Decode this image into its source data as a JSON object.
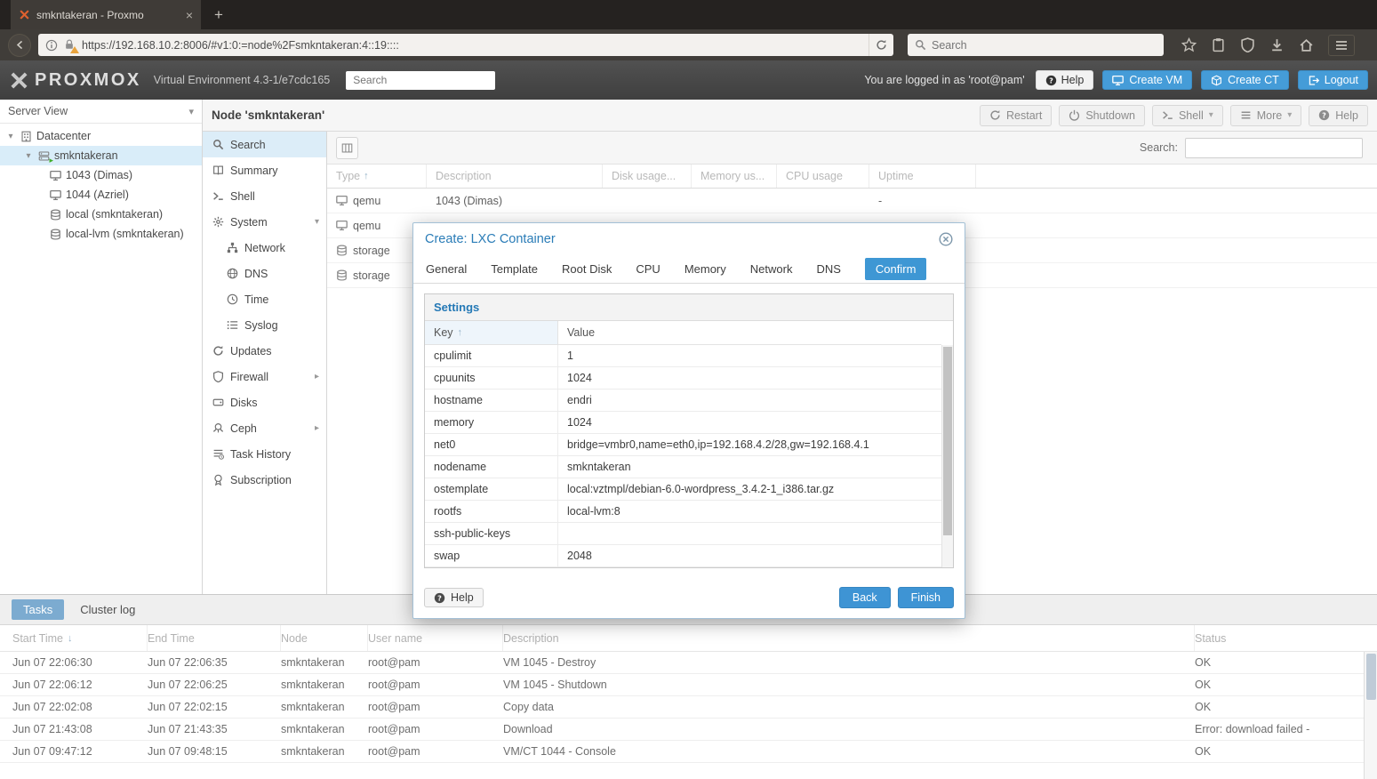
{
  "colors": {
    "button_blue": "#459cd8",
    "modal_title_blue": "#2a7cb7",
    "active_tab_blue": "#3e97d4",
    "tree_selection_blue": "#d9edf9",
    "tasks_active_tab_blue": "#7cabd0",
    "favicon_orange": "#e0612e",
    "header_dark_gray": "#454545"
  },
  "glyphs": {
    "close": "×",
    "plus": "+",
    "caret_down": "▾",
    "caret_right": "▸",
    "sort_asc": "↑",
    "sort_desc": "↓"
  },
  "browser": {
    "tab_title": "smkntakeran - Proxmo",
    "url": "https://192.168.10.2:8006/#v1:0:=node%2Fsmkntakeran:4::19::::",
    "search_placeholder": "Search"
  },
  "pve_header": {
    "brand": "PROXMOX",
    "subtitle": "Virtual Environment 4.3-1/e7cdc165",
    "search_placeholder": "Search",
    "login_status": "You are logged in as 'root@pam'",
    "buttons": {
      "help": "Help",
      "create_vm": "Create VM",
      "create_ct": "Create CT",
      "logout": "Logout"
    }
  },
  "tree": {
    "view_label": "Server View",
    "items": [
      {
        "label": "Datacenter",
        "icon": "datacenter-icon"
      },
      {
        "label": "smkntakeran",
        "icon": "node-icon",
        "selected": true,
        "running": true
      },
      {
        "label": "1043 (Dimas)",
        "icon": "vm-icon"
      },
      {
        "label": "1044 (Azriel)",
        "icon": "vm-icon"
      },
      {
        "label": "local (smkntakeran)",
        "icon": "storage-icon"
      },
      {
        "label": "local-lvm (smkntakeran)",
        "icon": "storage-icon"
      }
    ]
  },
  "node_header": {
    "title": "Node 'smkntakeran'",
    "buttons": [
      {
        "label": "Restart",
        "icon": "restart-icon"
      },
      {
        "label": "Shutdown",
        "icon": "shutdown-icon"
      },
      {
        "label": "Shell",
        "icon": "shell-icon",
        "dropdown": true
      },
      {
        "label": "More",
        "icon": "more-icon",
        "dropdown": true
      },
      {
        "label": "Help",
        "icon": "help-icon"
      }
    ]
  },
  "node_menu": {
    "items": [
      {
        "label": "Search",
        "icon": "search-icon",
        "active": true
      },
      {
        "label": "Summary",
        "icon": "summary-icon"
      },
      {
        "label": "Shell",
        "icon": "shell-icon"
      },
      {
        "label": "System",
        "icon": "system-gear-icon",
        "expanded": true
      },
      {
        "label": "Network",
        "icon": "network-icon",
        "child": true
      },
      {
        "label": "DNS",
        "icon": "dns-globe-icon",
        "child": true
      },
      {
        "label": "Time",
        "icon": "clock-icon",
        "child": true
      },
      {
        "label": "Syslog",
        "icon": "syslog-icon",
        "child": true
      },
      {
        "label": "Updates",
        "icon": "updates-icon"
      },
      {
        "label": "Firewall",
        "icon": "firewall-shield-icon",
        "submenu": true
      },
      {
        "label": "Disks",
        "icon": "disks-icon"
      },
      {
        "label": "Ceph",
        "icon": "ceph-icon",
        "submenu": true
      },
      {
        "label": "Task History",
        "icon": "task-history-icon"
      },
      {
        "label": "Subscription",
        "icon": "subscription-icon"
      }
    ]
  },
  "grid": {
    "search_label": "Search:",
    "columns": [
      "Type",
      "Description",
      "Disk usage...",
      "Memory us...",
      "CPU usage",
      "Uptime"
    ],
    "sort_column": "Type",
    "rows": [
      {
        "type": "qemu",
        "icon": "vm-icon",
        "description": "1043 (Dimas)",
        "disk": "",
        "memory": "",
        "cpu": "",
        "uptime": "-"
      },
      {
        "type": "qemu",
        "icon": "vm-icon",
        "description": "",
        "disk": "",
        "memory": "",
        "cpu": "",
        "uptime": ""
      },
      {
        "type": "storage",
        "icon": "storage-icon",
        "description": "",
        "disk": "",
        "memory": "",
        "cpu": "",
        "uptime": ""
      },
      {
        "type": "storage",
        "icon": "storage-icon",
        "description": "",
        "disk": "",
        "memory": "",
        "cpu": "",
        "uptime": ""
      }
    ]
  },
  "modal": {
    "title": "Create: LXC Container",
    "tabs": [
      "General",
      "Template",
      "Root Disk",
      "CPU",
      "Memory",
      "Network",
      "DNS",
      "Confirm"
    ],
    "active_tab": "Confirm",
    "panel_title": "Settings",
    "columns": {
      "key": "Key",
      "value": "Value"
    },
    "rows": [
      {
        "key": "cpulimit",
        "value": "1"
      },
      {
        "key": "cpuunits",
        "value": "1024"
      },
      {
        "key": "hostname",
        "value": "endri"
      },
      {
        "key": "memory",
        "value": "1024"
      },
      {
        "key": "net0",
        "value": "bridge=vmbr0,name=eth0,ip=192.168.4.2/28,gw=192.168.4.1"
      },
      {
        "key": "nodename",
        "value": "smkntakeran"
      },
      {
        "key": "ostemplate",
        "value": "local:vztmpl/debian-6.0-wordpress_3.4.2-1_i386.tar.gz"
      },
      {
        "key": "rootfs",
        "value": "local-lvm:8"
      },
      {
        "key": "ssh-public-keys",
        "value": ""
      },
      {
        "key": "swap",
        "value": "2048"
      }
    ],
    "footer": {
      "help": "Help",
      "back": "Back",
      "finish": "Finish"
    }
  },
  "tasks": {
    "tabs": [
      {
        "label": "Tasks",
        "active": true
      },
      {
        "label": "Cluster log"
      }
    ],
    "columns": [
      "Start Time",
      "End Time",
      "Node",
      "User name",
      "Description",
      "Status"
    ],
    "sort_column": "Start Time",
    "rows": [
      {
        "start": "Jun 07 22:06:30",
        "end": "Jun 07 22:06:35",
        "node": "smkntakeran",
        "user": "root@pam",
        "description": "VM 1045 - Destroy",
        "status": "OK"
      },
      {
        "start": "Jun 07 22:06:12",
        "end": "Jun 07 22:06:25",
        "node": "smkntakeran",
        "user": "root@pam",
        "description": "VM 1045 - Shutdown",
        "status": "OK"
      },
      {
        "start": "Jun 07 22:02:08",
        "end": "Jun 07 22:02:15",
        "node": "smkntakeran",
        "user": "root@pam",
        "description": "Copy data",
        "status": "OK"
      },
      {
        "start": "Jun 07 21:43:08",
        "end": "Jun 07 21:43:35",
        "node": "smkntakeran",
        "user": "root@pam",
        "description": "Download",
        "status": "Error: download failed -"
      },
      {
        "start": "Jun 07 09:47:12",
        "end": "Jun 07 09:48:15",
        "node": "smkntakeran",
        "user": "root@pam",
        "description": "VM/CT 1044 - Console",
        "status": "OK"
      }
    ]
  }
}
